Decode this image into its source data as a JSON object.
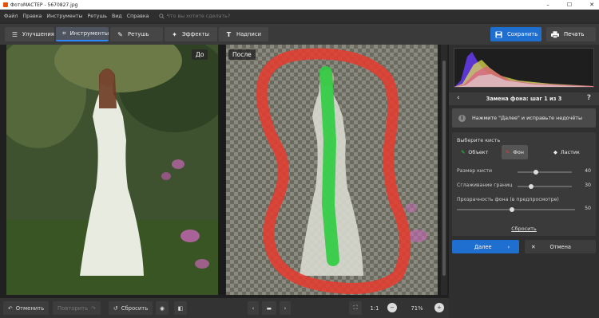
{
  "window": {
    "title": "ФотоМАСТЕР - 5670827.jpg",
    "minimize": "–",
    "maximize": "☐",
    "close": "✕"
  },
  "menu": {
    "items": [
      "Файл",
      "Правка",
      "Инструменты",
      "Ретушь",
      "Вид",
      "Справка"
    ],
    "search_placeholder": "Что вы хотите сделать?"
  },
  "tabs": [
    {
      "label": "Улучшения",
      "icon": "sliders-icon"
    },
    {
      "label": "Инструменты",
      "icon": "crop-icon",
      "active": true
    },
    {
      "label": "Ретушь",
      "icon": "brush-icon"
    },
    {
      "label": "Эффекты",
      "icon": "magic-wand-icon"
    },
    {
      "label": "Надписи",
      "icon": "text-icon"
    }
  ],
  "actions": {
    "save": "Сохранить",
    "print": "Печать"
  },
  "canvas": {
    "before_label": "До",
    "after_label": "После"
  },
  "bottom": {
    "undo": "Отменить",
    "redo": "Повторить",
    "reset": "Сбросить",
    "one_to_one": "1:1",
    "zoom": "71%"
  },
  "panel": {
    "step_title": "Замена фона: шаг 1 из 3",
    "hint": "Нажмите \"Далее\" и исправьте недочёты",
    "brush_title": "Выберите кисть",
    "brushes": [
      "Объект",
      "Фон",
      "Ластик"
    ],
    "active_brush": "Фон",
    "sliders": [
      {
        "label": "Размер кисти",
        "value": 40
      },
      {
        "label": "Сглаживание границ",
        "value": 30
      },
      {
        "label": "Прозрачность фона (в предпросмотре)",
        "value": 50
      }
    ],
    "reset_link": "Сбросить",
    "next": "Далее",
    "cancel": "Отмена"
  },
  "colors": {
    "accent": "#1f6fd1",
    "object_brush": "#2ecc40",
    "background_brush": "#e63b2e"
  }
}
